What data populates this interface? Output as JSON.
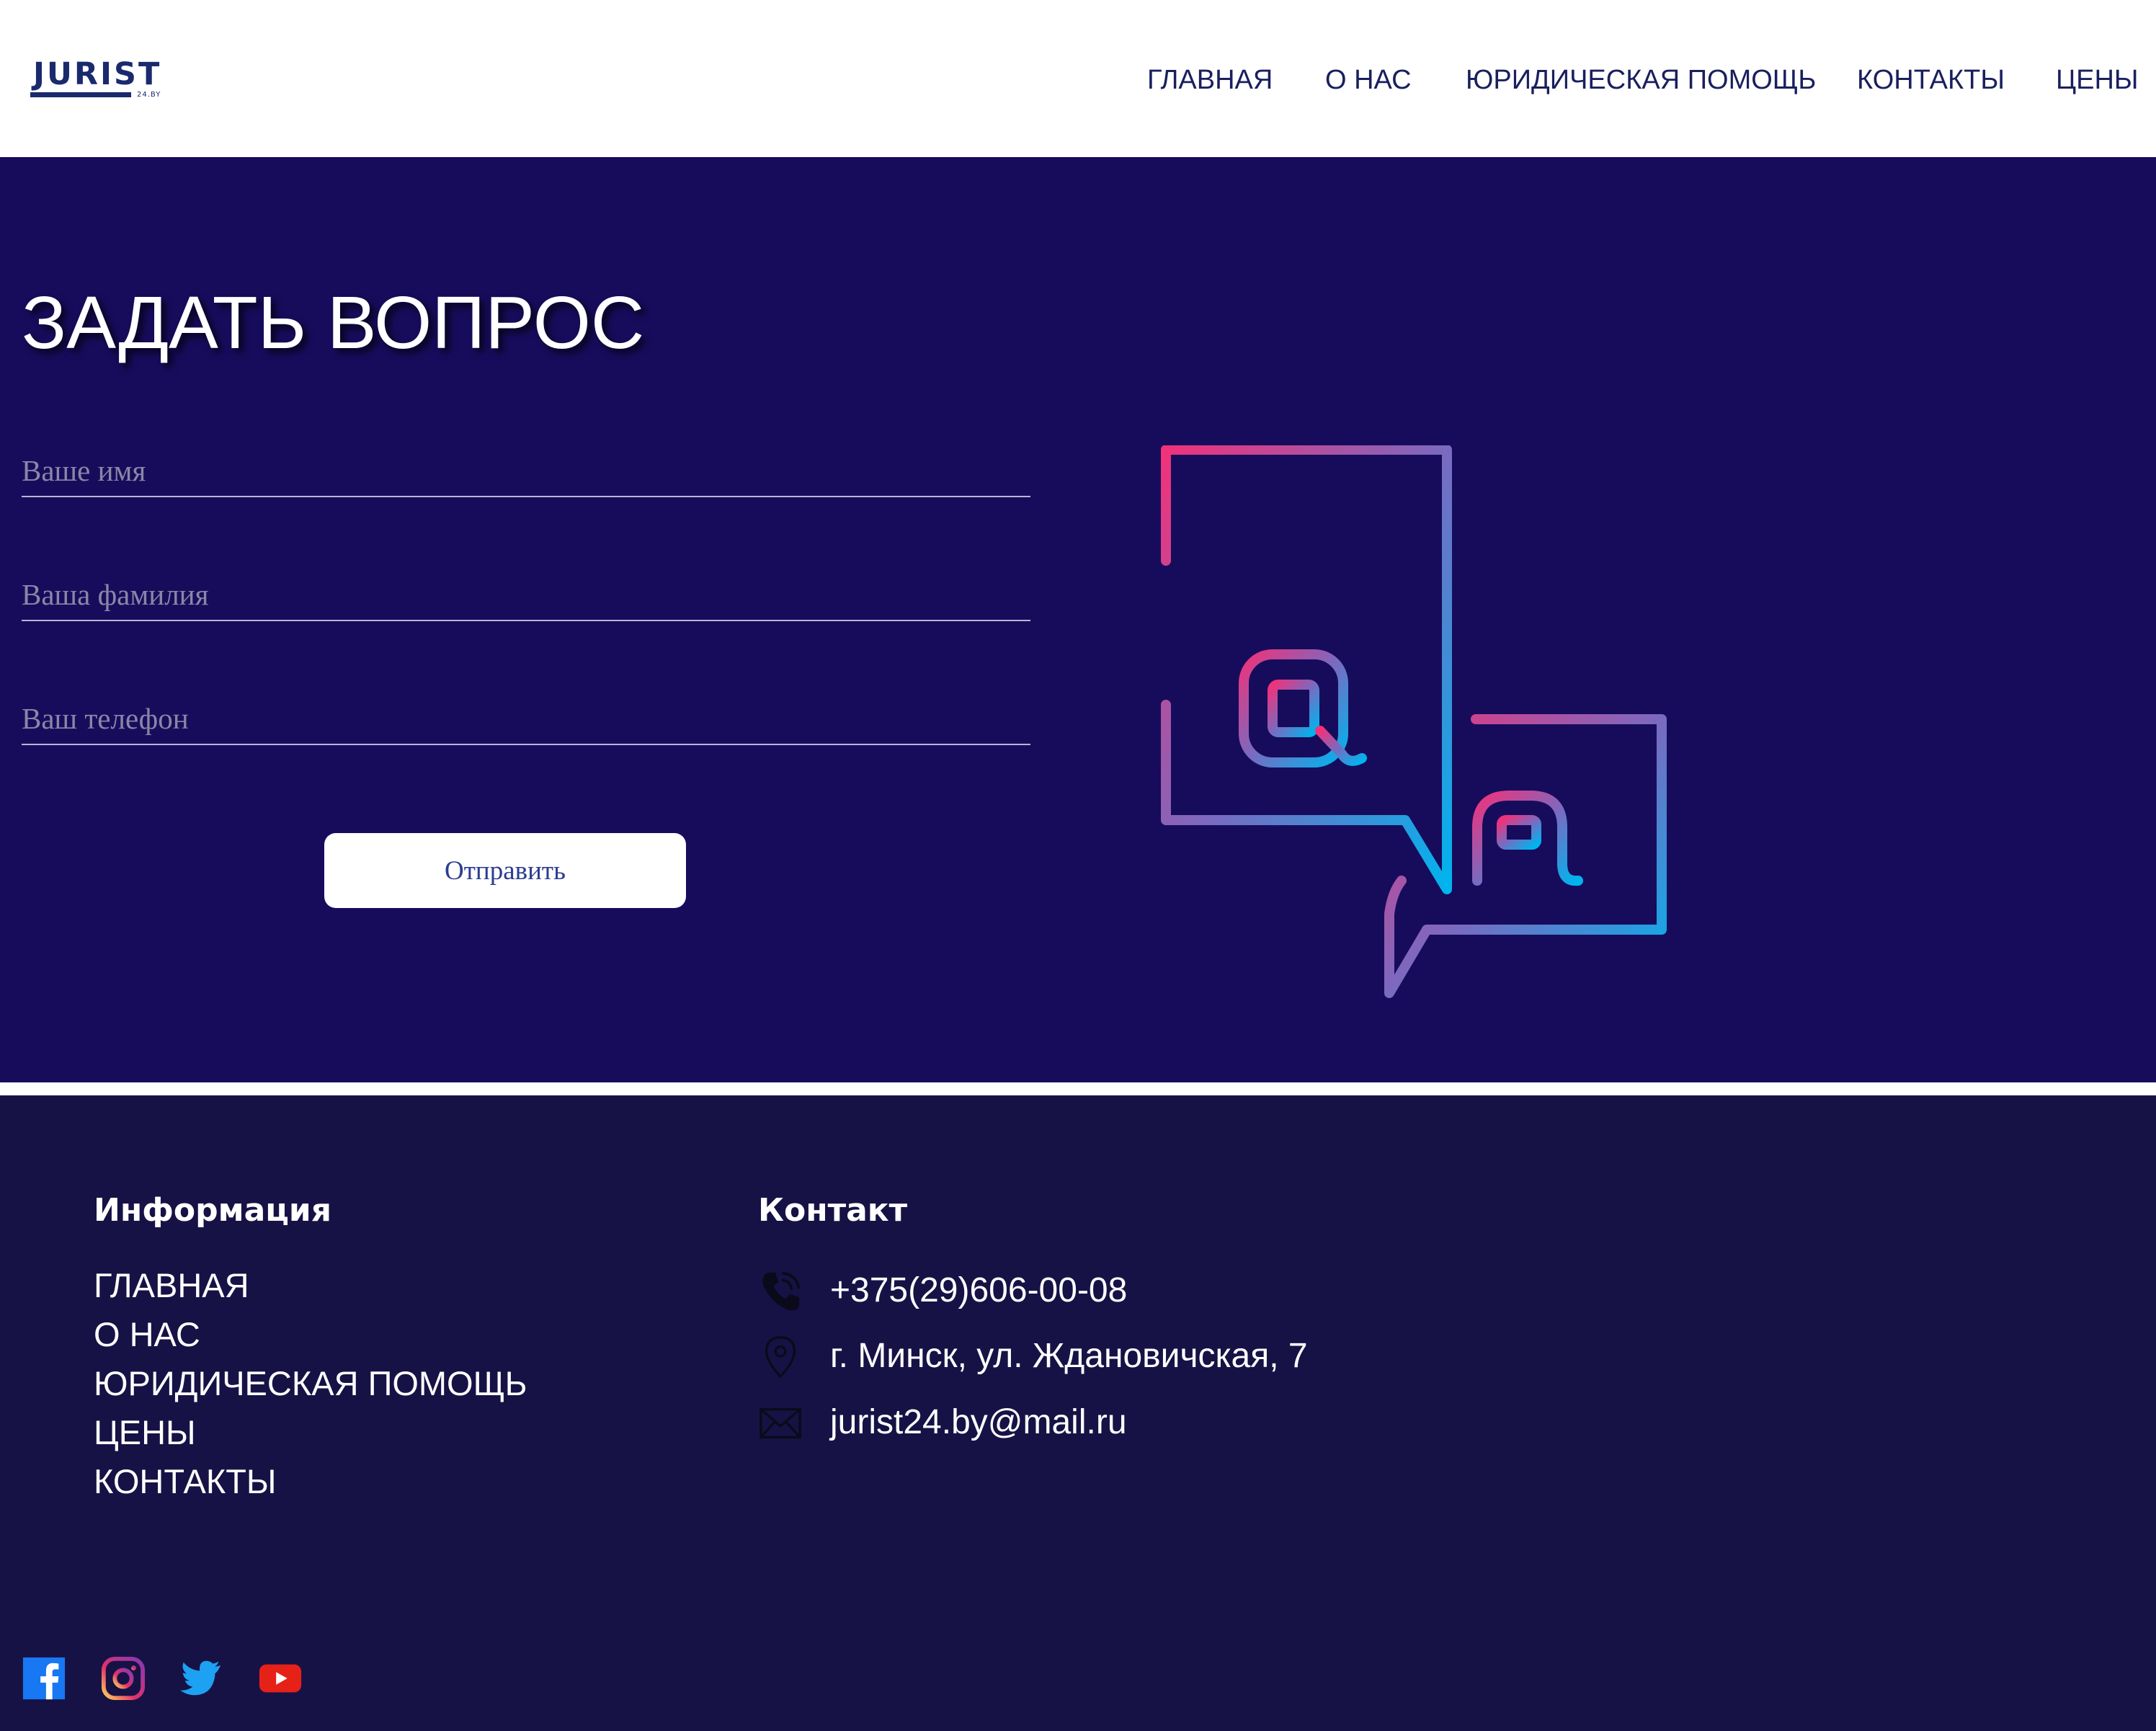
{
  "header": {
    "logo": {
      "word": "JURIST",
      "sub": "24.BY"
    },
    "nav": {
      "main": "ГЛАВНАЯ",
      "about": "О НАС",
      "legal_help": "ЮРИДИЧЕСКАЯ ПОМОЩЬ",
      "contacts": "КОНТАКТЫ",
      "prices": "ЦЕНЫ"
    }
  },
  "form": {
    "title": "ЗАДАТЬ ВОПРОС",
    "name_placeholder": "Ваше имя",
    "surname_placeholder": "Ваша фамилия",
    "phone_placeholder": "Ваш телефон",
    "submit_label": "Отправить",
    "illustration": "question-answer-icon"
  },
  "footer": {
    "info_heading": "Информация",
    "links": [
      "ГЛАВНАЯ",
      "О НАС",
      "ЮРИДИЧЕСКАЯ ПОМОЩЬ",
      "ЦЕНЫ",
      "КОНТАКТЫ"
    ],
    "contact_heading": "Контакт",
    "contact": {
      "phone": "+375(29)606-00-08",
      "address": "г. Минск, ул. Ждановичская, 7",
      "email": "jurist24.by@mail.ru"
    },
    "social": [
      "facebook-icon",
      "instagram-icon",
      "twitter-icon",
      "youtube-icon"
    ]
  },
  "colors": {
    "hero_bg": "#170c5c",
    "footer_bg": "#171245",
    "nav_text": "#1a1f5e",
    "gradient_start": "#f0327a",
    "gradient_end": "#00b4ee"
  }
}
